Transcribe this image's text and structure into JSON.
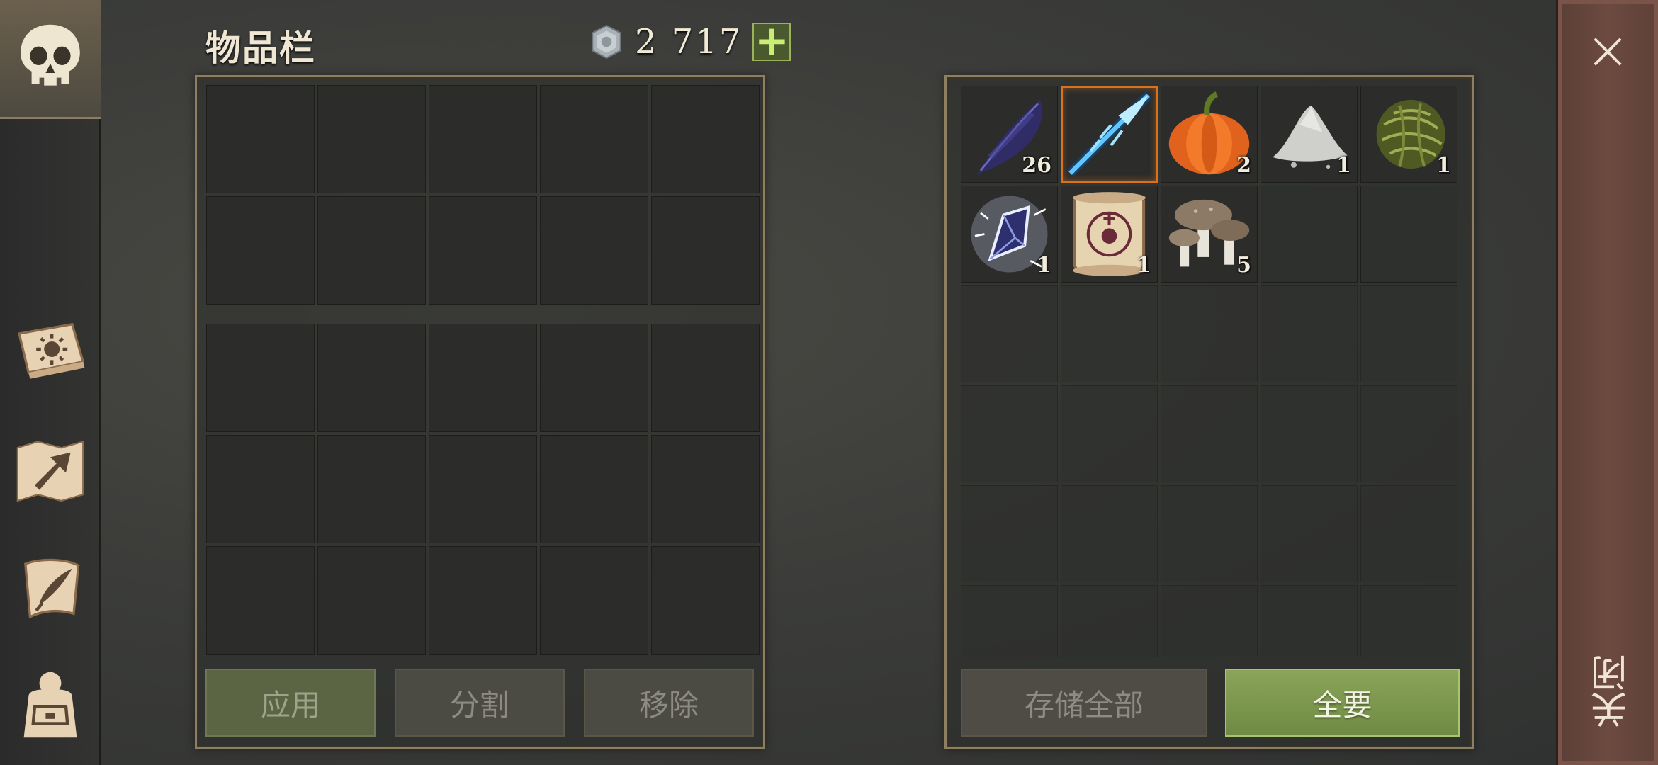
{
  "sidebar": {
    "items": [
      {
        "icon": "skull-icon",
        "active": true
      },
      {
        "icon": "sun-book-icon",
        "active": false
      },
      {
        "icon": "map-arrow-icon",
        "active": false
      },
      {
        "icon": "quill-scroll-icon",
        "active": false
      },
      {
        "icon": "backpack-icon",
        "active": false
      }
    ]
  },
  "header": {
    "title": "物品栏",
    "currency_value": "2 717",
    "currency_icon": "coin-icon",
    "add_label": "+"
  },
  "inventory_actions": {
    "apply": "应用",
    "split": "分割",
    "remove": "移除"
  },
  "storage": {
    "items": [
      {
        "name": "feather",
        "icon": "feather-icon",
        "count": "26",
        "selected": false
      },
      {
        "name": "ice-spear",
        "icon": "ice-spear-icon",
        "count": "",
        "selected": true
      },
      {
        "name": "pumpkin",
        "icon": "pumpkin-icon",
        "count": "2",
        "selected": false
      },
      {
        "name": "powder-pile",
        "icon": "powder-pile-icon",
        "count": "1",
        "selected": false
      },
      {
        "name": "grass-ball",
        "icon": "grass-ball-icon",
        "count": "1",
        "selected": false
      },
      {
        "name": "crystal-shard",
        "icon": "crystal-shard-icon",
        "count": "1",
        "selected": false
      },
      {
        "name": "rune-scroll",
        "icon": "rune-scroll-icon",
        "count": "1",
        "selected": false
      },
      {
        "name": "mushrooms",
        "icon": "mushrooms-icon",
        "count": "5",
        "selected": false
      }
    ],
    "store_all": "存储全部",
    "take_all": "全要"
  },
  "close": {
    "label": "关闭",
    "icon": "close-icon"
  },
  "colors": {
    "accent_green": "#8aa559",
    "selected_border": "#d7731f",
    "panel_border": "#8e7f60"
  }
}
